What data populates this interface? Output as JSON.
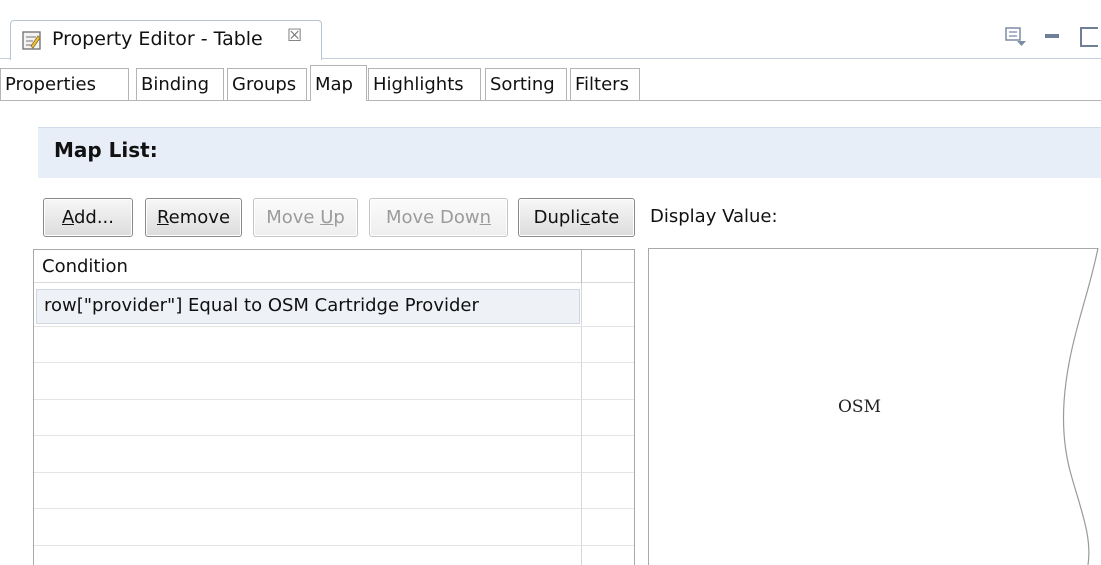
{
  "view": {
    "title": "Property Editor - Table",
    "close_glyph": "☒",
    "icons": [
      "property-editor-icon",
      "close-icon",
      "view-menu-icon",
      "minimize-icon",
      "maximize-icon"
    ]
  },
  "tabs": [
    {
      "label": "Properties",
      "active": false
    },
    {
      "label": "Binding",
      "active": false
    },
    {
      "label": "Groups",
      "active": false
    },
    {
      "label": "Map",
      "active": true
    },
    {
      "label": "Highlights",
      "active": false
    },
    {
      "label": "Sorting",
      "active": false
    },
    {
      "label": "Filters",
      "active": false
    }
  ],
  "map_list": {
    "title": "Map List:",
    "buttons": {
      "add": {
        "pre": "",
        "mnemonic": "A",
        "post": "dd...",
        "enabled": true
      },
      "remove": {
        "pre": "",
        "mnemonic": "R",
        "post": "emove",
        "enabled": true
      },
      "move_up": {
        "pre": "Move ",
        "mnemonic": "U",
        "post": "p",
        "enabled": false
      },
      "move_down": {
        "pre": "Move Dow",
        "mnemonic": "n",
        "post": "",
        "enabled": false
      },
      "duplicate": {
        "pre": "Dupli",
        "mnemonic": "c",
        "post": "ate",
        "enabled": true
      }
    },
    "display_value_label": "Display Value:",
    "table": {
      "columns": [
        "Condition",
        ""
      ],
      "rows": [
        {
          "condition": "row[\"provider\"] Equal to OSM Cartridge Provider",
          "selected": true
        }
      ]
    },
    "display_value": "OSM"
  },
  "colors": {
    "header_bg": "#e7eef8",
    "selected_row_bg": "#eef1f6",
    "tab_border": "#b4b4b4"
  }
}
